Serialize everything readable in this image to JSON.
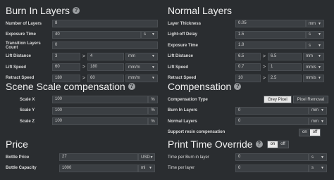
{
  "burn_in": {
    "title": "Burn In Layers",
    "rows": [
      {
        "label": "Number of Layers",
        "value": "8"
      },
      {
        "label": "Exposure Time",
        "value": "40",
        "unit": "s"
      },
      {
        "label": "Transition Layers Count",
        "value": "0"
      },
      {
        "label": "Lift Distance",
        "value": "3",
        "value2": "4",
        "unit": "mm"
      },
      {
        "label": "Lift Speed",
        "value": "60",
        "value2": "180",
        "unit": "mm/m"
      },
      {
        "label": "Retract Speed",
        "value": "180",
        "value2": "60",
        "unit": "mm/m"
      }
    ]
  },
  "normal": {
    "title": "Normal Layers",
    "rows": [
      {
        "label": "Layer Thickness",
        "value": "0.05",
        "unit": "mm"
      },
      {
        "label": "Light-off Delay",
        "value": "1.5",
        "unit": "s"
      },
      {
        "label": "Exposure Time",
        "value": "1.8",
        "unit": "s"
      },
      {
        "label": "Lift Distance",
        "value": "6.5",
        "value2": "6.5",
        "unit": "mm"
      },
      {
        "label": "Lift Speed",
        "value": "0.7",
        "value2": "1",
        "unit": "mm/s"
      },
      {
        "label": "Retract Speed",
        "value": "10",
        "value2": "2.5",
        "unit": "mm/s"
      }
    ]
  },
  "scale": {
    "title": "Scene Scale compensation",
    "rows": [
      {
        "label": "Scale X",
        "value": "100",
        "unit": "%"
      },
      {
        "label": "Scale Y",
        "value": "100",
        "unit": "%"
      },
      {
        "label": "Scale Z",
        "value": "100",
        "unit": "%"
      }
    ]
  },
  "compensation": {
    "title": "Compensation",
    "type_label": "Compensation Type",
    "type_options": [
      "Grey Pixel",
      "Pixel Removal"
    ],
    "burn_label": "Burn In Layers",
    "burn_value": "0",
    "normal_label": "Normal Layers",
    "normal_value": "0",
    "unit": "mm",
    "support_label": "Support resin compensation",
    "on": "on",
    "off": "off"
  },
  "price": {
    "title": "Price",
    "bottle_price_label": "Bottle Price",
    "bottle_price_value": "27",
    "bottle_price_unit": "USD",
    "bottle_capacity_label": "Bottle Capacity",
    "bottle_capacity_value": "1000",
    "bottle_capacity_unit": "ml"
  },
  "override": {
    "title": "Print Time Override",
    "on": "on",
    "off": "off",
    "burn_label": "Time per Burn in layer",
    "burn_value": "0",
    "normal_label": "Time per layer",
    "normal_value": "0",
    "unit": "s"
  },
  "icons": {
    "help": "?"
  }
}
